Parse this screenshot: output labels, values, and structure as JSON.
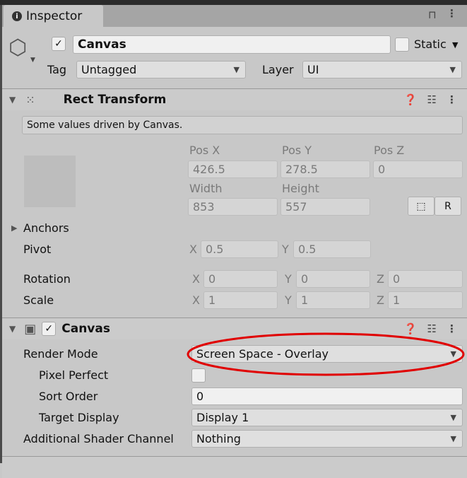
{
  "window": {
    "tab_title": "Inspector"
  },
  "object": {
    "name": "Canvas",
    "active": true,
    "static_label": "Static",
    "static": false,
    "tag_label": "Tag",
    "tag": "Untagged",
    "layer_label": "Layer",
    "layer": "UI"
  },
  "rect_transform": {
    "title": "Rect Transform",
    "driven_note": "Some values driven by Canvas.",
    "pos_x_label": "Pos X",
    "pos_y_label": "Pos Y",
    "pos_z_label": "Pos Z",
    "pos_x": "426.5",
    "pos_y": "278.5",
    "pos_z": "0",
    "width_label": "Width",
    "height_label": "Height",
    "width": "853",
    "height": "557",
    "raw_button": "R",
    "anchors_label": "Anchors",
    "pivot_label": "Pivot",
    "pivot_x": "0.5",
    "pivot_y": "0.5",
    "rotation_label": "Rotation",
    "rot_x": "0",
    "rot_y": "0",
    "rot_z": "0",
    "scale_label": "Scale",
    "scale_x": "1",
    "scale_y": "1",
    "scale_z": "1",
    "x": "X",
    "y": "Y",
    "z": "Z"
  },
  "canvas": {
    "title": "Canvas",
    "enabled": true,
    "render_mode_label": "Render Mode",
    "render_mode": "Screen Space - Overlay",
    "pixel_perfect_label": "Pixel Perfect",
    "pixel_perfect": false,
    "sort_order_label": "Sort Order",
    "sort_order": "0",
    "target_display_label": "Target Display",
    "target_display": "Display 1",
    "shader_channel_label": "Additional Shader Channel",
    "shader_channel": "Nothing"
  },
  "colors": {
    "highlight_ellipse": "#e00000"
  }
}
